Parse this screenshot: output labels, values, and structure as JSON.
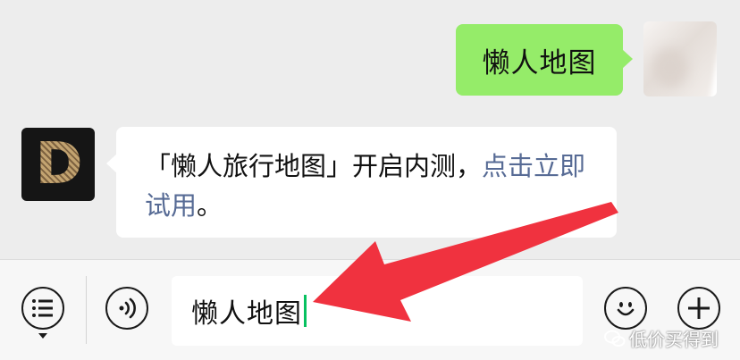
{
  "chat": {
    "outgoing_message": "懒人地图",
    "incoming_message": {
      "text": "「懒人旅行地图」开启内测，",
      "link": "点击立即试用",
      "end": "。"
    },
    "bot_avatar_letter": "D"
  },
  "input_bar": {
    "input_value": "懒人地图",
    "icons": [
      "menu-list-icon",
      "voice-icon",
      "emoji-icon",
      "plus-icon"
    ]
  },
  "watermark": "低价买得到",
  "colors": {
    "outgoing_bubble": "#95ec69",
    "incoming_bubble": "#ffffff",
    "link": "#576b95",
    "background": "#ededed",
    "annotation_arrow": "#f0323f",
    "caret": "#07c160"
  }
}
